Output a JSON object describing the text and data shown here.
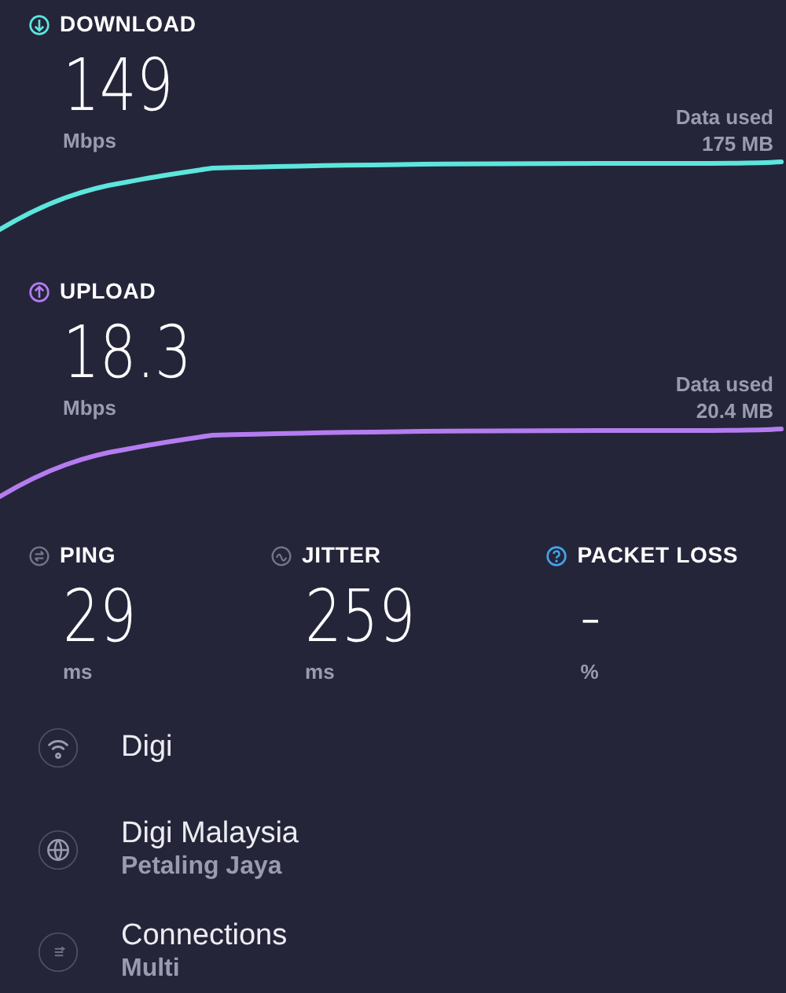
{
  "speeds": [
    {
      "kind": "download",
      "label": "DOWNLOAD",
      "value": "149",
      "unit": "Mbps",
      "data_label": "Data used",
      "data_value": "175 MB",
      "color": "#5ce6dc"
    },
    {
      "kind": "upload",
      "label": "UPLOAD",
      "value": "18.3",
      "unit": "Mbps",
      "data_label": "Data used",
      "data_value": "20.4 MB",
      "color": "#b57cf0"
    }
  ],
  "metrics": [
    {
      "kind": "ping",
      "label": "PING",
      "value": "29",
      "unit": "ms"
    },
    {
      "kind": "jitter",
      "label": "JITTER",
      "value": "259",
      "unit": "ms"
    },
    {
      "kind": "packet_loss",
      "label": "PACKET LOSS",
      "value": "-",
      "unit": "%"
    }
  ],
  "info": [
    {
      "kind": "wifi",
      "title": "Digi"
    },
    {
      "kind": "globe",
      "title": "Digi Malaysia",
      "subtitle": "Petaling Jaya"
    },
    {
      "kind": "connections",
      "title": "Connections",
      "subtitle": "Multi"
    }
  ]
}
